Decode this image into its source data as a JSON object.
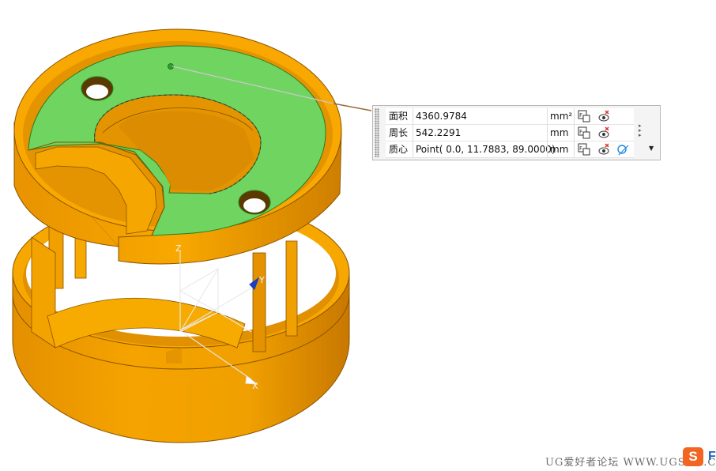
{
  "measure": {
    "rows": [
      {
        "label": "面积",
        "value": "4360.9784",
        "unit": "mm²"
      },
      {
        "label": "周长",
        "value": "542.2291",
        "unit": "mm"
      },
      {
        "label": "质心",
        "value": "Point( 0.0, 11.7883, 89.0000)",
        "unit": "mm"
      }
    ],
    "icons": [
      "expression-icon",
      "show-hide-icon",
      "point-display-icon"
    ]
  },
  "axes": {
    "x": "X",
    "y": "Y",
    "z": "Z"
  },
  "watermark": "UG爱好者论坛 WWW.UGSNX.COM",
  "logo": "S",
  "edge_letter": "F",
  "colors": {
    "part_body": "#f5a000",
    "selected_face": "#6fd460",
    "panel_bg": "#f4f4f4"
  }
}
